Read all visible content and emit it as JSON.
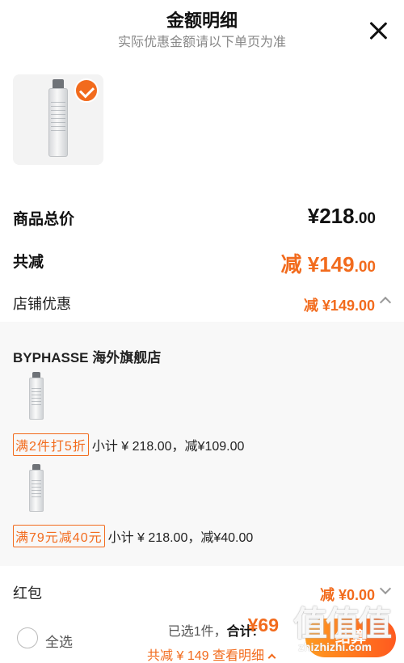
{
  "header": {
    "title": "金额明细",
    "subtitle": "实际优惠金额请以下单页为准"
  },
  "summary": {
    "total_label": "商品总价",
    "total_main": "¥218",
    "total_decimal": ".00",
    "discount_label": "共减",
    "discount_main": "减 ¥149",
    "discount_decimal": ".00",
    "store_discount_label": "店铺优惠",
    "store_discount_value": "减 ¥149.00"
  },
  "store": {
    "name": "BYPHASSE 海外旗舰店",
    "promotions": [
      {
        "tag": "满2件打5折",
        "detail": "小计 ¥ 218.00，减¥109.00"
      },
      {
        "tag": "满79元减40元",
        "detail": "小计 ¥ 218.00，减¥40.00"
      }
    ]
  },
  "hongbao": {
    "label": "红包",
    "value": "减 ¥0.00"
  },
  "bottom_bar": {
    "select_all": "全选",
    "selected_count": "已选1件，",
    "total_label": "合计: ",
    "amount": "¥69",
    "saved": "共减 ¥ 149",
    "view_detail": "查看明细",
    "checkout": "结算"
  },
  "watermark": {
    "big": "值值值",
    "url": "zhizhizhi.com"
  },
  "icons": [
    "close-icon",
    "check-icon",
    "chevron-up-icon",
    "chevron-down-icon",
    "radio-icon"
  ],
  "colors": {
    "accent": "#f26b1d",
    "panel": "#f8f8f8"
  }
}
